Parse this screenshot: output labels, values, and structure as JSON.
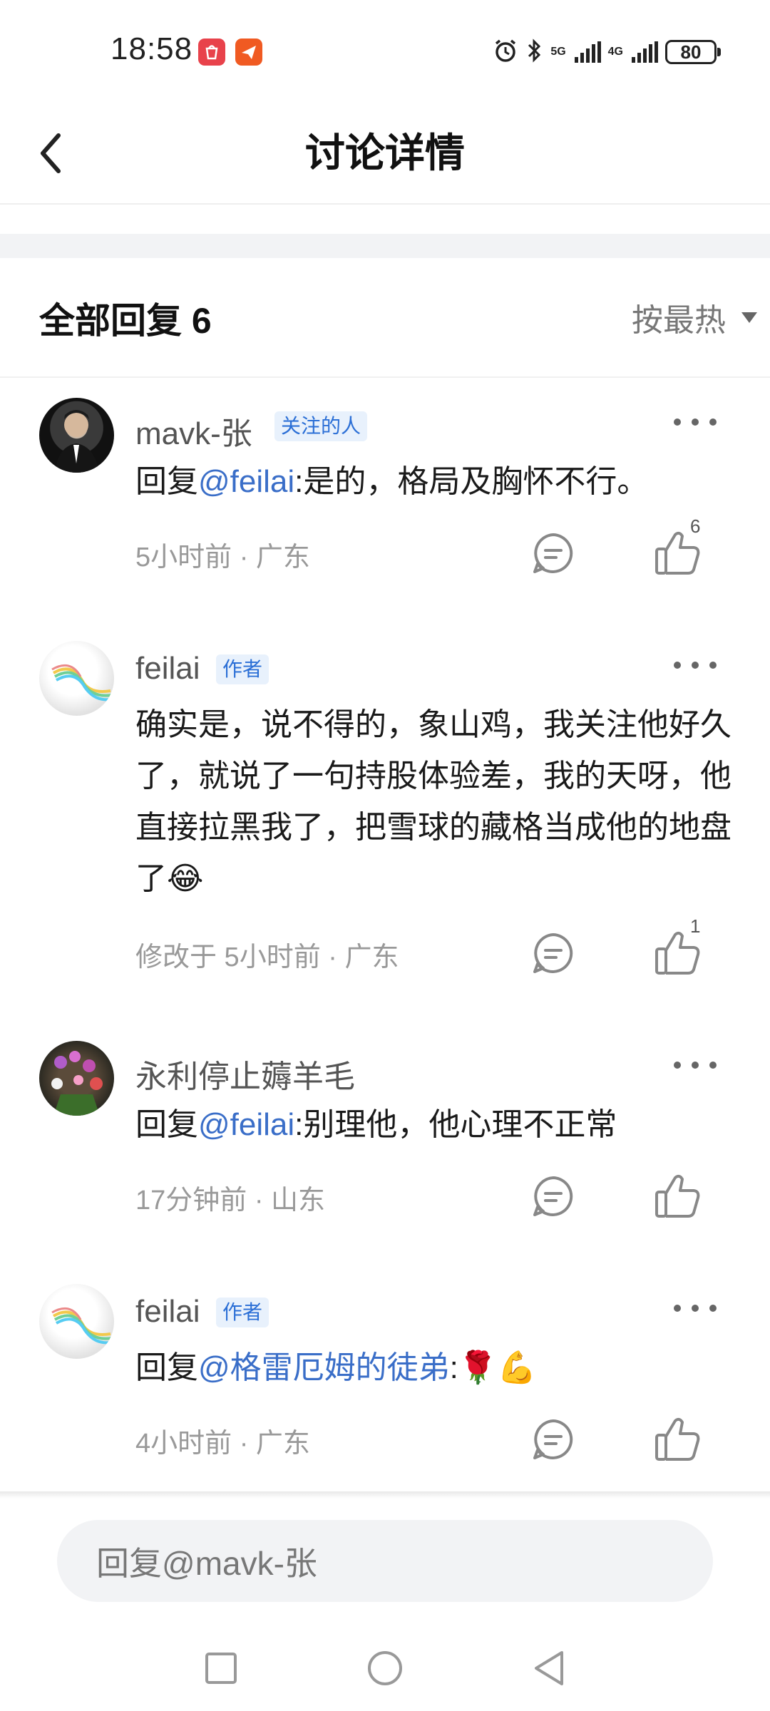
{
  "status_bar": {
    "time": "18:58",
    "network1": "5G",
    "network2": "4G",
    "battery": "80",
    "icons": [
      "huawei-app-icon",
      "paper-plane-app-icon",
      "alarm-icon",
      "bluetooth-icon",
      "signal-icon",
      "battery-icon"
    ]
  },
  "header": {
    "title": "讨论详情",
    "back_icon": "chevron-left-icon"
  },
  "section": {
    "title": "全部回复 6",
    "sort_label": "按最热"
  },
  "comments": [
    {
      "username": "mavk-张",
      "tag": "关注的人",
      "content_prefix": "回复",
      "mention": "@feilai",
      "content": ":是的，格局及胸怀不行。",
      "meta": "5小时前 · 广东",
      "likes": "6"
    },
    {
      "username": "feilai",
      "tag": "作者",
      "content": "确实是，说不得的，象山鸡，我关注他好久了，就说了一句持股体验差，我的天呀，他直接拉黑我了，把雪球的藏格当成他的地盘了",
      "emoji": "😂",
      "meta": "修改于 5小时前 · 广东",
      "likes": "1"
    },
    {
      "username": "永利停止薅羊毛",
      "content_prefix": "回复",
      "mention": "@feilai",
      "content": ":别理他，他心理不正常",
      "meta": "17分钟前 · 山东"
    },
    {
      "username": "feilai",
      "tag": "作者",
      "content_prefix": "回复",
      "mention": "@格雷厄姆的徒弟",
      "content": ":",
      "emoji": "🌹💪",
      "meta": "4小时前 · 广东"
    }
  ],
  "reply_bar": {
    "placeholder": "回复@mavk-张"
  },
  "colors": {
    "mention": "#3a6ec8",
    "tag_bg": "#e8f1fc",
    "tag_text": "#2b6fd6"
  }
}
